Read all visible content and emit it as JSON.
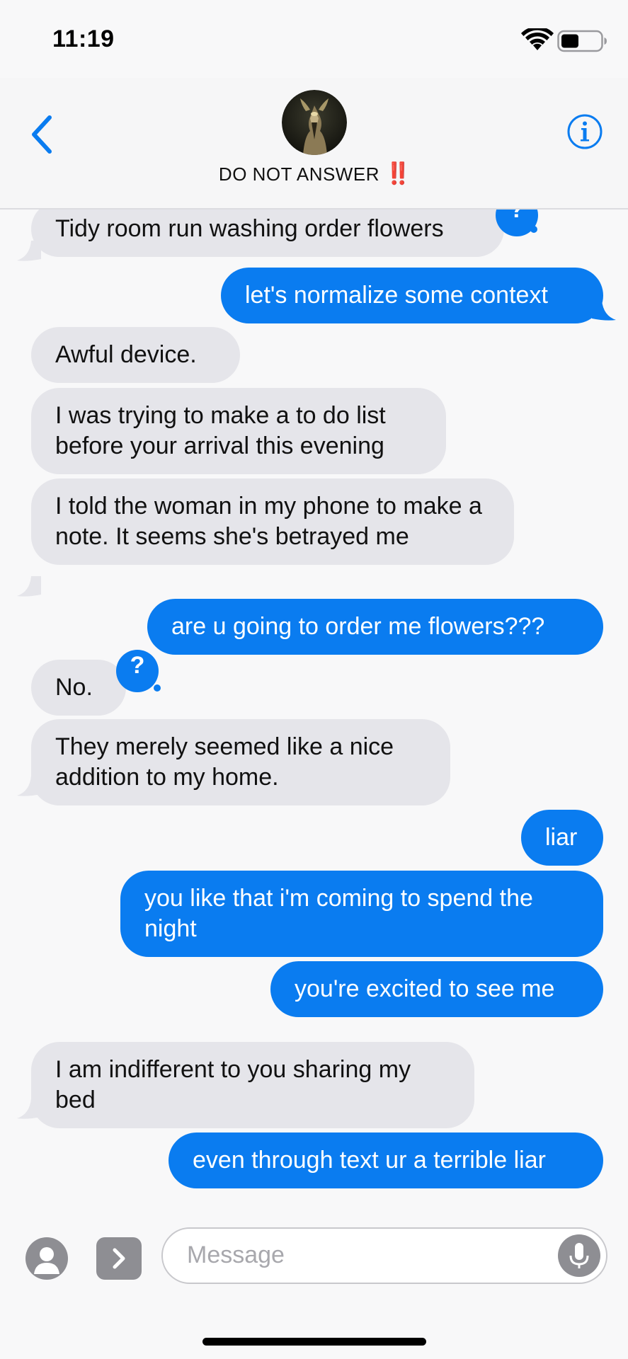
{
  "status_bar": {
    "time": "11:19"
  },
  "header": {
    "contact_name": "DO NOT ANSWER",
    "contact_emoji": "‼️",
    "back_icon": "chevron-left-icon",
    "info_icon": "info-icon"
  },
  "messages": [
    {
      "sender": "them",
      "text": "Tidy room run washing order flowers"
    },
    {
      "sender": "me",
      "text": "let's normalize some context"
    },
    {
      "sender": "them",
      "text": "Awful device."
    },
    {
      "sender": "them",
      "text": "I was trying to make a to do list before your arrival this evening"
    },
    {
      "sender": "them",
      "text": "I told the woman in my phone to make a note. It seems she's betrayed me"
    },
    {
      "sender": "me",
      "text": "are u going to order me flowers???"
    },
    {
      "sender": "them",
      "text": "No."
    },
    {
      "sender": "them",
      "text": "They merely seemed like a nice addition to my home."
    },
    {
      "sender": "me",
      "text": "liar"
    },
    {
      "sender": "me",
      "text": "you like that i'm coming to spend the night"
    },
    {
      "sender": "me",
      "text": "you're excited to see me"
    },
    {
      "sender": "them",
      "text": "I am indifferent to you sharing my bed"
    },
    {
      "sender": "me",
      "text": "even through text ur a terrible liar"
    }
  ],
  "input_bar": {
    "placeholder": "Message"
  },
  "colors": {
    "outgoing_bubble": "#0a7cf0",
    "incoming_bubble": "#e5e5ea",
    "accent": "#0a7cf0",
    "alert": "#e0202a"
  }
}
